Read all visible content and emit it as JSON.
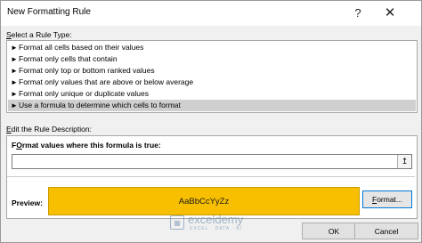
{
  "window": {
    "title": "New Formatting Rule",
    "help_icon": "?",
    "close_icon": "✕"
  },
  "rule_type": {
    "label_prefix": "",
    "label_hotkey": "S",
    "label_rest": "elect a Rule Type:",
    "items": [
      "Format all cells based on their values",
      "Format only cells that contain",
      "Format only top or bottom ranked values",
      "Format only values that are above or below average",
      "Format only unique or duplicate values",
      "Use a formula to determine which cells to format"
    ],
    "selected_index": 5,
    "item_arrow": "►"
  },
  "description": {
    "label_hotkey": "E",
    "label_rest": "dit the Rule Description:",
    "formula_label_hotkey": "O",
    "formula_label_pre": "F",
    "formula_label_rest": "rmat values where this formula is true:",
    "formula_value": "",
    "range_button_icon": "↥",
    "preview_label": "Preview:",
    "preview_sample": "AaBbCcYyZz",
    "format_button_hotkey": "F",
    "format_button_rest": "ormat..."
  },
  "buttons": {
    "ok": "OK",
    "cancel": "Cancel"
  },
  "watermark": {
    "name": "exceldemy",
    "tagline": "EXCEL · DATA · BI"
  },
  "colors": {
    "preview_fill": "#F7BF00",
    "selected_row": "#CFCFCF",
    "focus_border": "#0078D7"
  }
}
